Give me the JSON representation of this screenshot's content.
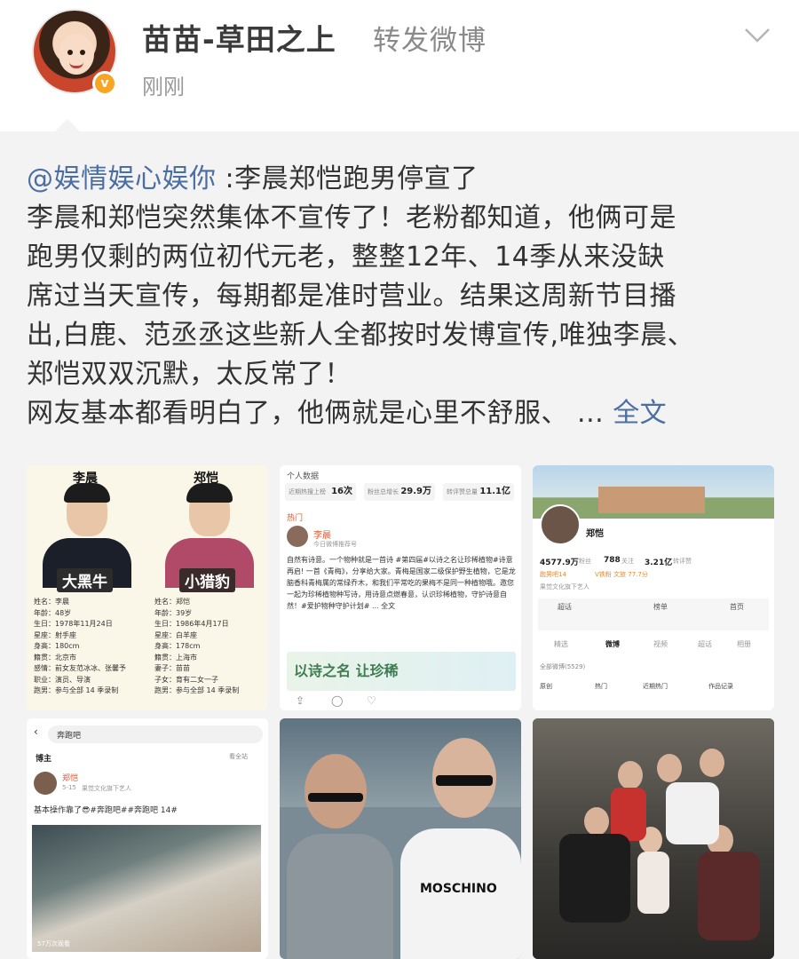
{
  "header": {
    "username": "苗苗-草田之上",
    "action": "转发微博",
    "time": "刚刚",
    "avatar": "avatar",
    "verified_icon": "verified-badge-icon",
    "menu_icon": "chevron-down-icon"
  },
  "repost": {
    "mention": "@娱情娱心娱你",
    "headline": " :李晨郑恺跑男停宣了",
    "lines": [
      "李晨和郑恺突然集体不宣传了！老粉都知道，他俩可是",
      "跑男仅剩的两位初代元老，整整12年、14季从来没缺",
      "席过当天宣传，每期都是准时营业。结果这周新节目播",
      "出,白鹿、范丞丞这些新人全都按时发博宣传,唯独李晨、",
      "郑恺双双沉默，太反常了！"
    ],
    "last_line": "网友基本都看明白了，他俩就是心里不舒服、 ... ",
    "full_text": "全文"
  },
  "images": {
    "img1": {
      "left_name": "李晨",
      "right_name": "郑恺",
      "left_nick": "大黑牛",
      "right_nick": "小猎豹",
      "left_info": [
        "姓名：李晨",
        "年龄：48岁",
        "生日：1978年11月24日",
        "星座：射手座",
        "身高：180cm",
        "籍贯：北京市",
        "感情：前女友范冰冰、张馨予",
        "职业：演员、导演",
        "跑男：参与全部 14 季录制"
      ],
      "right_info": [
        "姓名：郑恺",
        "年龄：39岁",
        "生日：1986年4月17日",
        "星座：白羊座",
        "身高：178cm",
        "籍贯：上海市",
        "妻子：苗苗",
        "子女：育有二女一子",
        "跑男：参与全部 14 季录制"
      ]
    },
    "img2": {
      "section": "个人数据",
      "stats": [
        {
          "label": "近期热搜上榜",
          "value": "16次"
        },
        {
          "label": "粉丝总增长",
          "value": "29.9万"
        },
        {
          "label": "转评赞总量",
          "value": "11.1亿"
        }
      ],
      "hot": "热门",
      "poster": "李晨",
      "poster_sub": "今日微博推荐号",
      "text": "自然有诗意。一个物种就是一首诗 #第四届#以诗之名让珍稀植物#诗意再启! 一首《青梅》，分享给大家。青梅是国家二级保护野生植物，它是龙脑香科青梅属的常绿乔木，和我们平常吃的果梅不是同一种植物哦。邀您一起为珍稀植物种写诗，用诗意点燃春意，认识珍稀植物，守护诗意自然！#爱护物种守护计划# ... 全文",
      "banner": "以诗之名 让珍稀"
    },
    "img3": {
      "name": "郑恺",
      "followers": "4577.9万",
      "followers_label": "粉丝",
      "following": "788",
      "following_label": "关注",
      "likes": "3.21亿",
      "likes_label": "转评赞",
      "tags": [
        "跑男吧14",
        "V铁粉 文旅 77.7分"
      ],
      "company": "果觉文化旗下艺人",
      "tabs": [
        "精选",
        "微博",
        "视频",
        "超话",
        "相册"
      ],
      "all_posts": "全部微博(5529)",
      "filters": [
        "原创",
        "热门",
        "近期热门",
        "作品记录"
      ],
      "quick": [
        "超话",
        "榜单",
        "首页"
      ]
    },
    "img4": {
      "search": "奔跑吧",
      "tab": "博主",
      "tab_right": "看全站",
      "poster": "郑恺",
      "date": "5-15",
      "company": "果觉文化旗下艺人",
      "text": "基本操作靠了😎#奔跑吧##奔跑吧 14#",
      "views": "57万次观看"
    },
    "img5": {
      "shirt": "MOSCHINO"
    },
    "img6": {
      "scene": "group-photo"
    }
  }
}
